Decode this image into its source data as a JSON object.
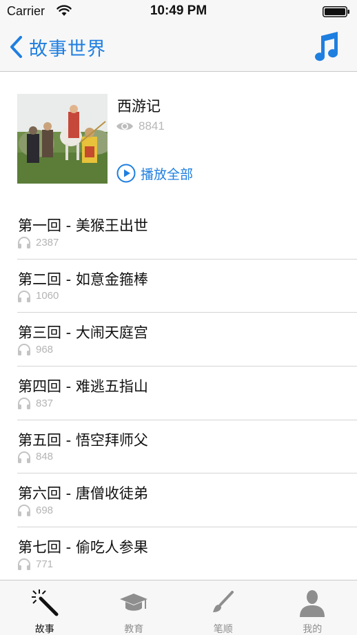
{
  "status_bar": {
    "carrier": "Carrier",
    "time": "10:49 PM",
    "icons": [
      "wifi-icon",
      "battery-icon"
    ]
  },
  "nav": {
    "back_label": "故事世界",
    "back_icon": "chevron-left-icon",
    "right_icon": "music-note-icon",
    "accent_color": "#1f7fe0"
  },
  "album": {
    "title": "西游记",
    "views": "8841",
    "views_icon": "eye-icon",
    "play_all_label": "播放全部",
    "play_icon": "play-circle-icon"
  },
  "episodes": [
    {
      "title": "第一回 - 美猴王出世",
      "plays": "2387"
    },
    {
      "title": "第二回 - 如意金箍棒",
      "plays": "1060"
    },
    {
      "title": "第三回 - 大闹天庭宫",
      "plays": "968"
    },
    {
      "title": "第四回 - 难逃五指山",
      "plays": "837"
    },
    {
      "title": "第五回 - 悟空拜师父",
      "plays": "848"
    },
    {
      "title": "第六回 - 唐僧收徒弟",
      "plays": "698"
    },
    {
      "title": "第七回 - 偷吃人参果",
      "plays": "771"
    }
  ],
  "tabs": [
    {
      "label": "故事",
      "icon": "magic-wand-icon",
      "active": true
    },
    {
      "label": "教育",
      "icon": "graduation-cap-icon",
      "active": false
    },
    {
      "label": "笔顺",
      "icon": "paintbrush-icon",
      "active": false
    },
    {
      "label": "我的",
      "icon": "person-icon",
      "active": false
    }
  ]
}
